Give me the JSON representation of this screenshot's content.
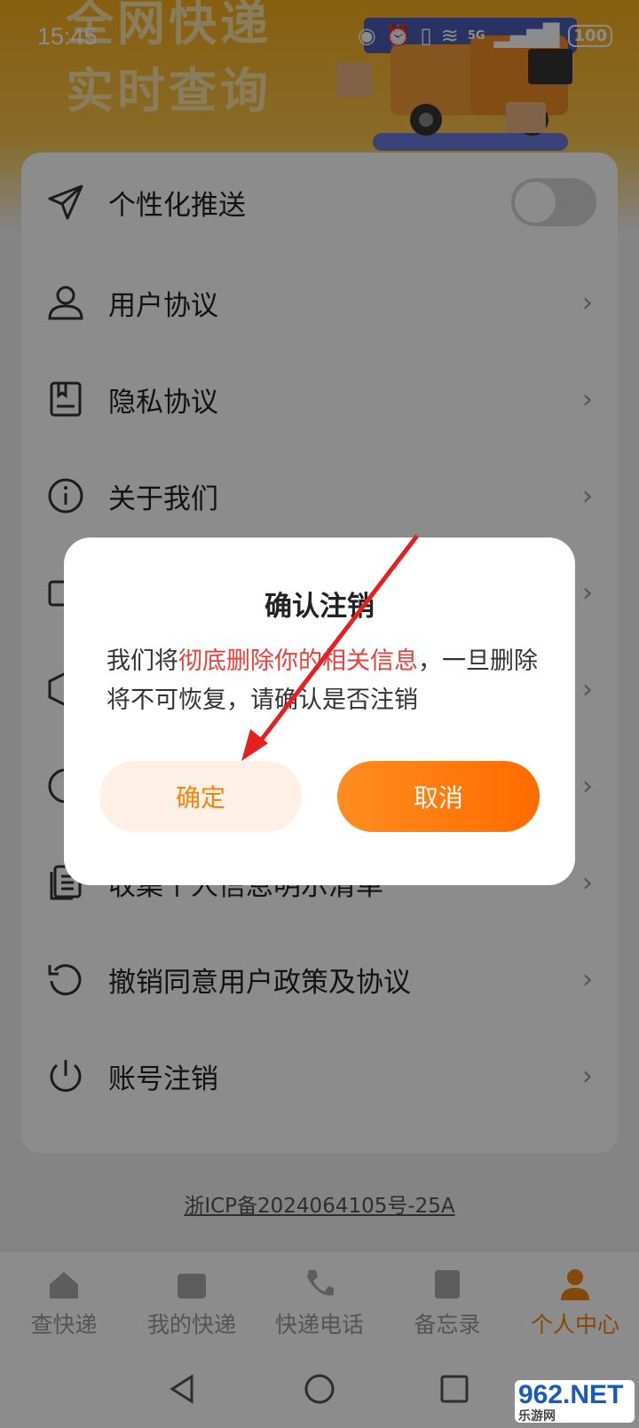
{
  "status": {
    "time": "15:45",
    "battery": "100",
    "network": "5G"
  },
  "banner": {
    "line1": "全网快递",
    "line2": "实时查询"
  },
  "settings": {
    "items": [
      {
        "label": "个性化推送",
        "icon": "send-icon",
        "type": "toggle",
        "on": false
      },
      {
        "label": "用户协议",
        "icon": "user-icon",
        "type": "link"
      },
      {
        "label": "隐私协议",
        "icon": "document-icon",
        "type": "link"
      },
      {
        "label": "关于我们",
        "icon": "info-icon",
        "type": "link"
      },
      {
        "label": "",
        "icon": "mail-icon",
        "type": "link"
      },
      {
        "label": "",
        "icon": "box-icon",
        "type": "link"
      },
      {
        "label": "",
        "icon": "clock-icon",
        "type": "link"
      },
      {
        "label": "收集个人信息明示清单",
        "icon": "list-icon",
        "type": "link"
      },
      {
        "label": "撤销同意用户政策及协议",
        "icon": "undo-icon",
        "type": "link"
      },
      {
        "label": "账号注销",
        "icon": "power-icon",
        "type": "link"
      }
    ]
  },
  "icp": "浙ICP备2024064105号-25A",
  "nav": {
    "items": [
      {
        "label": "查快递",
        "icon": "home-icon"
      },
      {
        "label": "我的快递",
        "icon": "package-icon"
      },
      {
        "label": "快递电话",
        "icon": "phone-icon"
      },
      {
        "label": "备忘录",
        "icon": "memo-icon"
      },
      {
        "label": "个人中心",
        "icon": "person-icon"
      }
    ],
    "active": 4
  },
  "dialog": {
    "title": "确认注销",
    "msg_prefix": "我们将",
    "msg_highlight": "彻底删除你的相关信息",
    "msg_suffix": "，一旦删除将不可恢复，请确认是否注销",
    "confirm_label": "确定",
    "cancel_label": "取消"
  },
  "watermark": {
    "main": "962.NET",
    "sub": "乐游网"
  },
  "colors": {
    "accent": "#f5840e",
    "highlight": "#e8413c",
    "banner": "#f6ad1d"
  }
}
